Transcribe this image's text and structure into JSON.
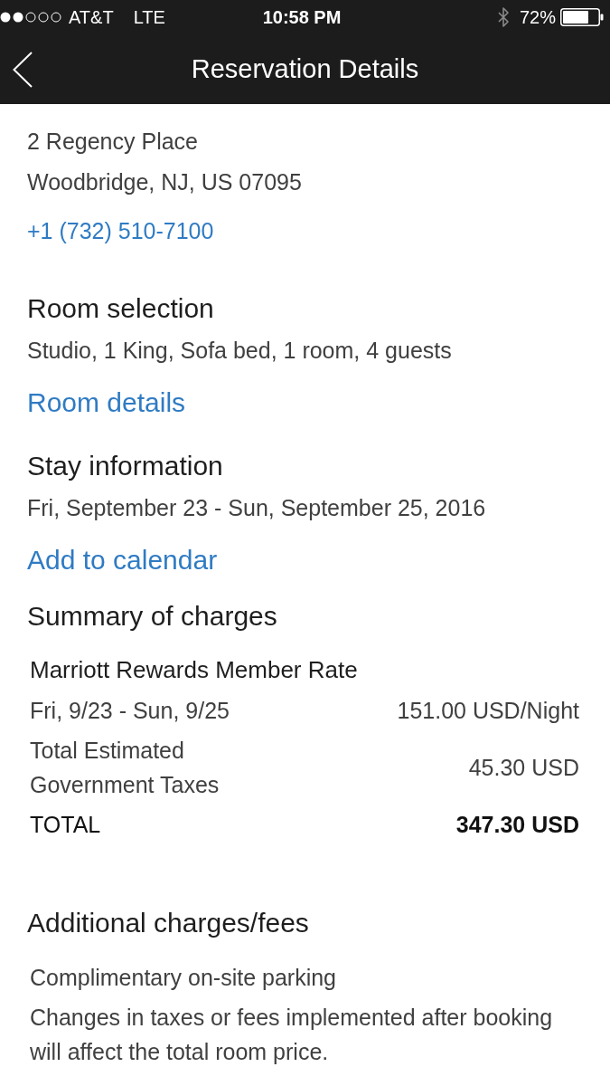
{
  "status_bar": {
    "carrier": "AT&T",
    "network": "LTE",
    "time": "10:58 PM",
    "battery": "72%"
  },
  "nav_bar": {
    "title": "Reservation Details"
  },
  "sections": [
    {
      "kind": "contact",
      "lines": [
        "2 Regency Place",
        "Woodbridge, NJ, US 07095"
      ],
      "phone": "+1 (732) 510-7100"
    },
    {
      "kind": "info",
      "heading": "Room selection",
      "text": "Studio, 1 King, Sofa bed, 1 room, 4 guests",
      "link": "Room details"
    },
    {
      "kind": "info",
      "heading": "Stay information",
      "text": "Fri, September 23 - Sun, September 25, 2016",
      "link": "Add to calendar"
    },
    {
      "kind": "charges",
      "heading": "Summary of charges",
      "rate": "Marriott Rewards Member Rate",
      "rows": [
        {
          "kind": "item",
          "label": "Fri, 9/23 - Sun, 9/25",
          "value": "151.00 USD/Night"
        },
        {
          "kind": "item",
          "label": "Total Estimated Government Taxes",
          "value": "45.30 USD"
        },
        {
          "kind": "total",
          "label": "TOTAL",
          "value": "347.30 USD"
        }
      ]
    },
    {
      "kind": "notes",
      "heading": "Additional charges/fees",
      "notes": [
        "Complimentary on-site parking",
        "Changes in taxes or fees implemented after booking will affect the total room price."
      ]
    }
  ]
}
